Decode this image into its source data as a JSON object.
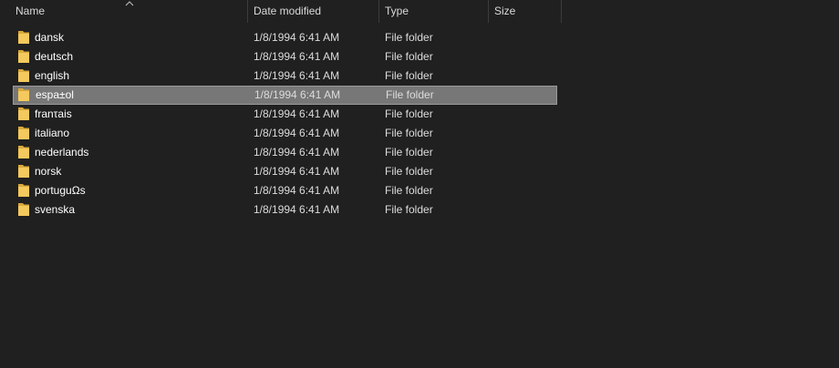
{
  "columns": {
    "name": "Name",
    "date_modified": "Date modified",
    "type": "Type",
    "size": "Size"
  },
  "sort": {
    "column": "name",
    "direction": "ascending",
    "icon": "sort-chevron-up-icon"
  },
  "selected_index": 3,
  "items": [
    {
      "name": "dansk",
      "date": "1/8/1994 6:41 AM",
      "type": "File folder",
      "size": ""
    },
    {
      "name": "deutsch",
      "date": "1/8/1994 6:41 AM",
      "type": "File folder",
      "size": ""
    },
    {
      "name": "english",
      "date": "1/8/1994 6:41 AM",
      "type": "File folder",
      "size": ""
    },
    {
      "name": "espa±ol",
      "date": "1/8/1994 6:41 AM",
      "type": "File folder",
      "size": ""
    },
    {
      "name": "franτais",
      "date": "1/8/1994 6:41 AM",
      "type": "File folder",
      "size": ""
    },
    {
      "name": "italiano",
      "date": "1/8/1994 6:41 AM",
      "type": "File folder",
      "size": ""
    },
    {
      "name": "nederlands",
      "date": "1/8/1994 6:41 AM",
      "type": "File folder",
      "size": ""
    },
    {
      "name": "norsk",
      "date": "1/8/1994 6:41 AM",
      "type": "File folder",
      "size": ""
    },
    {
      "name": "portuguΩs",
      "date": "1/8/1994 6:41 AM",
      "type": "File folder",
      "size": ""
    },
    {
      "name": "svenska",
      "date": "1/8/1994 6:41 AM",
      "type": "File folder",
      "size": ""
    }
  ],
  "colors": {
    "background": "#202020",
    "selection": "#777777",
    "folder": "#f4c95d"
  }
}
